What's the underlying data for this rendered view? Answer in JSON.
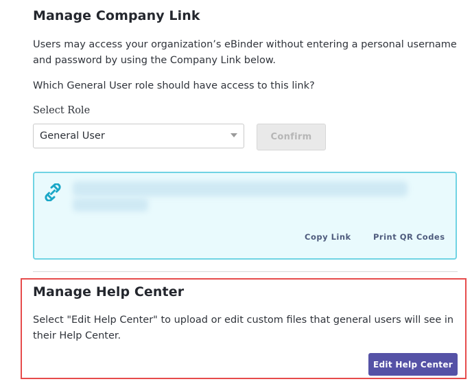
{
  "company_link": {
    "title": "Manage Company Link",
    "description": "Users may access your organization’s eBinder without entering a personal username and password by using the Company Link below.",
    "question": "Which General User role should have access to this link?",
    "select_label": "Select Role",
    "selected_role": "General User",
    "confirm_label": "Confirm",
    "copy_link_label": "Copy Link",
    "print_qr_label": "Print QR Codes"
  },
  "help_center": {
    "title": "Manage Help Center",
    "description": "Select \"Edit Help Center\" to upload or edit custom files that general users will see in their Help Center.",
    "edit_label": "Edit Help Center"
  },
  "colors": {
    "panel_border": "#6fd3e3",
    "panel_background": "#e9fafd",
    "link_icon": "#1aa7c7",
    "primary_button": "#5552a6",
    "highlight_border": "#e64b4b"
  }
}
